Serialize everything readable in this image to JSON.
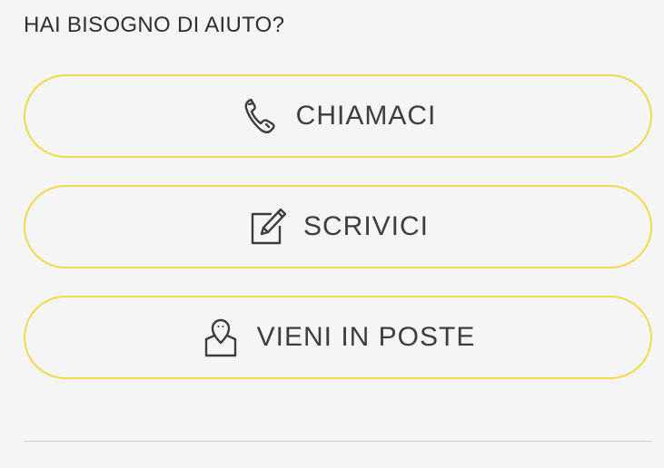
{
  "help": {
    "title": "HAI BISOGNO DI AIUTO?",
    "buttons": [
      {
        "label": "CHIAMACI",
        "icon": "phone-icon"
      },
      {
        "label": "SCRIVICI",
        "icon": "edit-icon"
      },
      {
        "label": "VIENI IN POSTE",
        "icon": "location-pin-icon"
      }
    ]
  },
  "colors": {
    "background": "#f5f5f5",
    "button_border": "#efd94a",
    "text": "#3d3d3d",
    "divider": "#cfcfcf"
  }
}
